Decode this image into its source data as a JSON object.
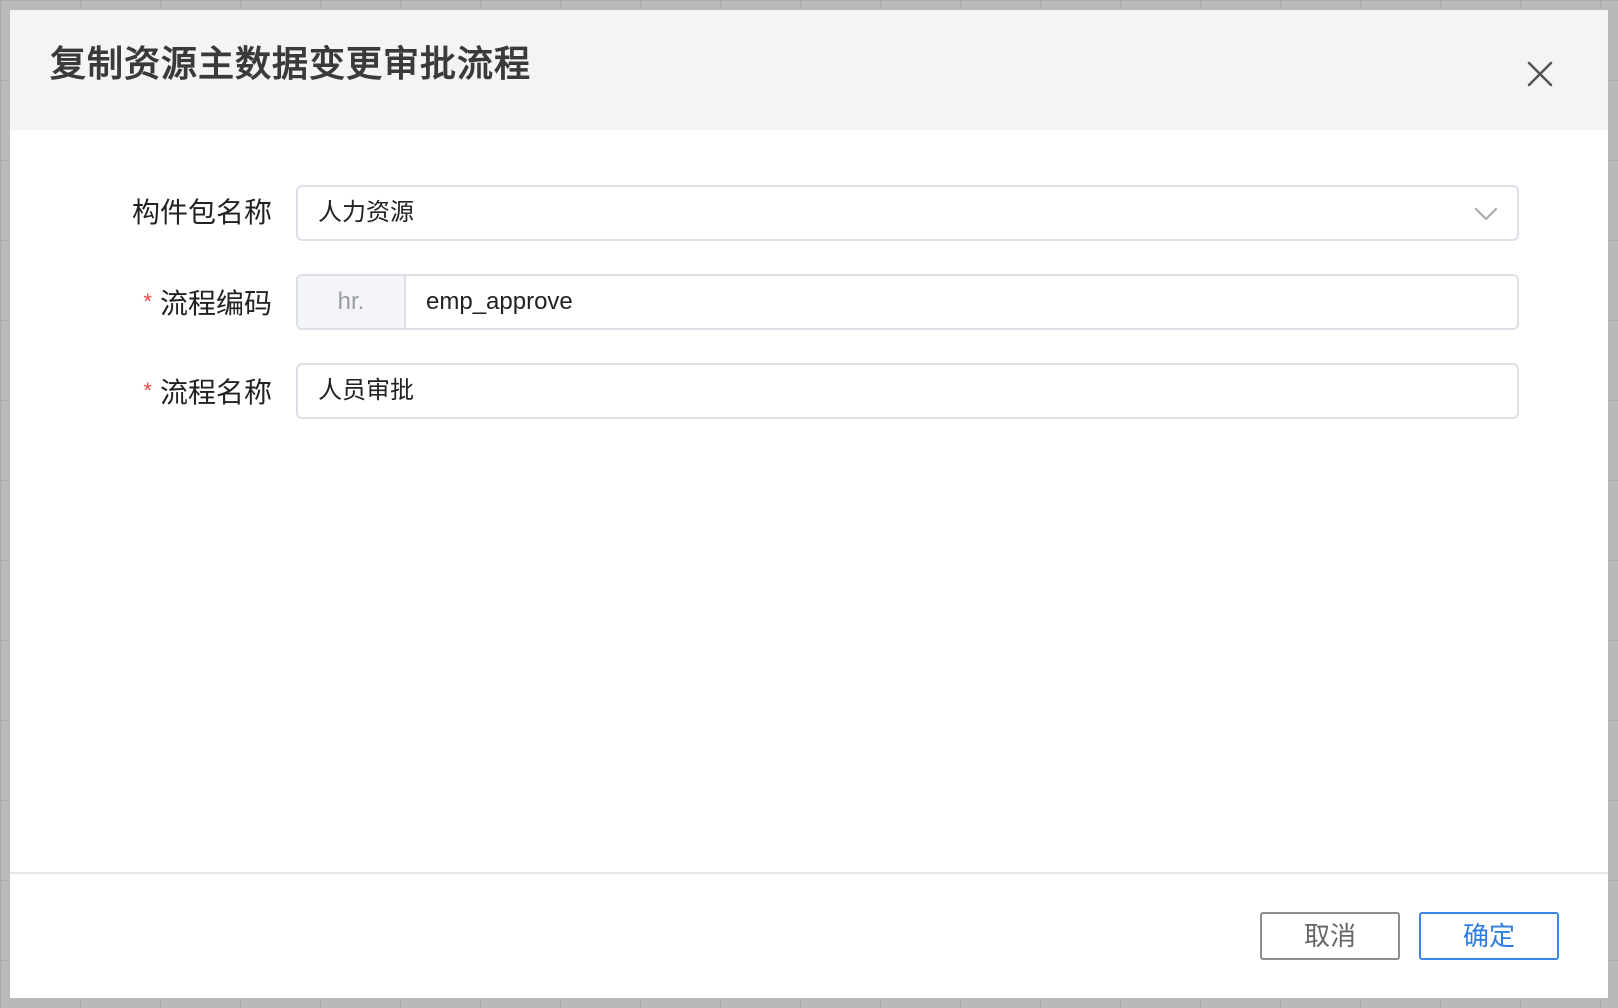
{
  "dialog": {
    "title": "复制资源主数据变更审批流程"
  },
  "form": {
    "package": {
      "label": "构件包名称",
      "value": "人力资源",
      "required": false
    },
    "process_code": {
      "label": "流程编码",
      "prefix": "hr.",
      "value": "emp_approve",
      "required": true,
      "required_mark": "*"
    },
    "process_name": {
      "label": "流程名称",
      "value": "人员审批",
      "required": true,
      "required_mark": "*"
    }
  },
  "footer": {
    "cancel_label": "取消",
    "ok_label": "确定"
  },
  "icons": {
    "close": "close-icon",
    "dropdown": "chevron-down-icon"
  },
  "colors": {
    "accent": "#2f7de1",
    "required": "#e94b4b",
    "header_bg": "#f4f4f5"
  }
}
